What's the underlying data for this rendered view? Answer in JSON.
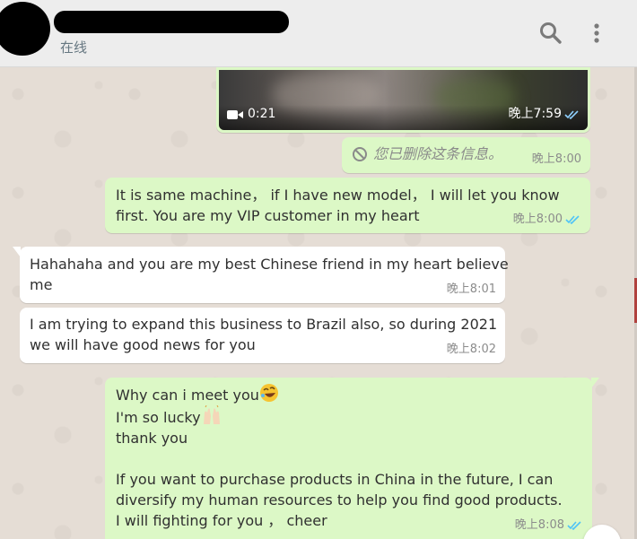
{
  "header": {
    "status": "在线",
    "icons": {
      "search": "search-icon",
      "menu": "more-vertical-icon"
    }
  },
  "messages": {
    "video": {
      "duration": "0:21",
      "time": "晚上7:59",
      "ticks": "read-double-check-icon"
    },
    "deleted": {
      "text": "您已删除这条信息。",
      "time": "晚上8:00"
    },
    "out1": {
      "lines": [
        "It is  same  machine，  if I  have new model，  I  will let  you know",
        "first. You are my  VIP customer in my  heart"
      ],
      "time": "晚上8:00"
    },
    "in1": {
      "lines": [
        "Hahahaha and you are my best Chinese friend in my heart believe",
        "me"
      ],
      "time": "晚上8:01"
    },
    "in2": {
      "lines": [
        "I am trying to expand this business to Brazil also, so during 2021",
        "we will have good news for you"
      ],
      "time": "晚上8:02"
    },
    "out2": {
      "line1": "Why can i meet you",
      "line2": "I'm so lucky",
      "line3": "thank you",
      "line5": "If you want to purchase  products in China in the future, I can",
      "line6": "diversify my human resources to help you find good products.",
      "line7": "I will  fighting for you ，  cheer",
      "time": "晚上8:08",
      "emoji1": "rolling-laughing-emoji",
      "emoji2": "raising-hands-emoji"
    }
  },
  "colors": {
    "outgoing": "#dcf8c6",
    "incoming": "#ffffff",
    "chat_bg": "#e5ddd5",
    "read_tick": "#4fc3f7"
  }
}
